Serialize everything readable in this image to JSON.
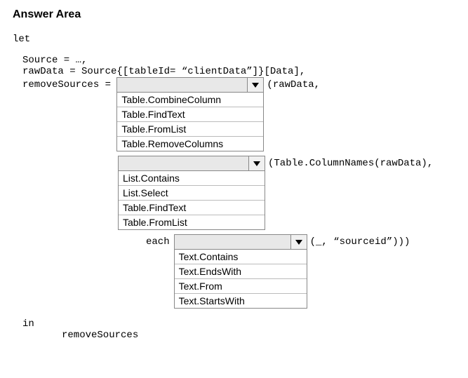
{
  "title": "Answer Area",
  "code": {
    "let": "let",
    "source_line": "Source = …,",
    "rawdata_line": "rawData = Source{[tableId= “clientData”]}[Data],",
    "remove_prefix": "removeSources = ",
    "after_dd1": "(rawData,",
    "after_dd2": "(Table.ColumnNames(rawData),",
    "each_label": "each",
    "after_dd3": "(_, “sourceid”)))",
    "in": "in",
    "final": "removeSources"
  },
  "dropdown1": {
    "options": [
      "Table.CombineColumn",
      "Table.FindText",
      "Table.FromList",
      "Table.RemoveColumns"
    ]
  },
  "dropdown2": {
    "options": [
      "List.Contains",
      "List.Select",
      "Table.FindText",
      "Table.FromList"
    ]
  },
  "dropdown3": {
    "options": [
      "Text.Contains",
      "Text.EndsWith",
      "Text.From",
      "Text.StartsWith"
    ]
  }
}
